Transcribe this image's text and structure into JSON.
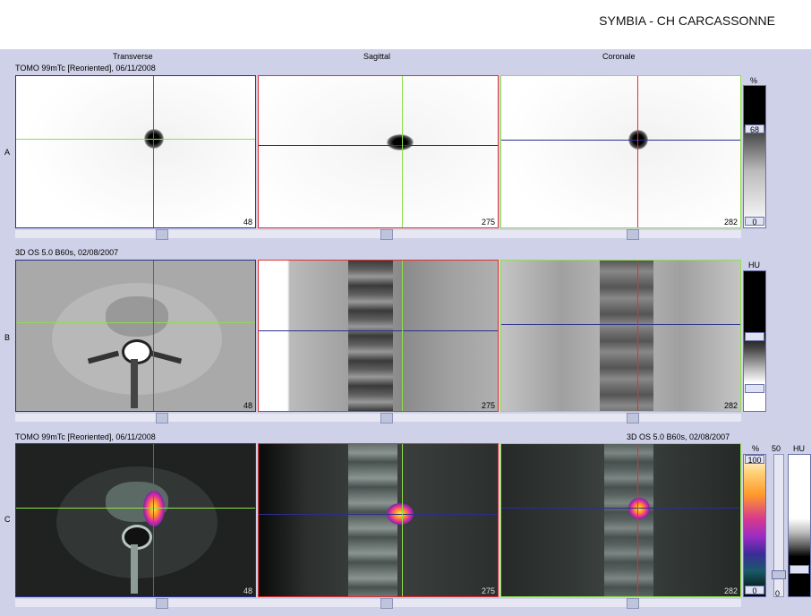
{
  "site": "SYMBIA - CH CARCASSONNE",
  "columns": [
    "Transverse",
    "Sagittal",
    "Coronale"
  ],
  "rows": {
    "A": {
      "label": "A",
      "info": "TOMO 99mTc [Reoriented], 06/11/2008",
      "slices": [
        "48",
        "275",
        "282"
      ],
      "scale_unit": "%",
      "scale_top": "68",
      "scale_bottom": "0"
    },
    "B": {
      "label": "B",
      "info": "3D  OS  5.0  B60s, 02/08/2007",
      "slices": [
        "48",
        "275",
        "282"
      ],
      "scale_unit": "HU"
    },
    "C": {
      "label": "C",
      "info_left": "TOMO 99mTc [Reoriented], 06/11/2008",
      "info_right": "3D  OS  5.0  B60s, 02/08/2007",
      "slices": [
        "48",
        "275",
        "282"
      ],
      "scale_unit": "%",
      "scale_top": "100",
      "scale_bottom": "0",
      "slider_top": "50",
      "slider_bottom": "0",
      "scale2_unit": "HU"
    }
  },
  "colors": {
    "background": "#cfd1e8",
    "transverse_border": "#2a2f8f",
    "sagittal_border": "#e03030",
    "coronal_border": "#8ee04a"
  }
}
